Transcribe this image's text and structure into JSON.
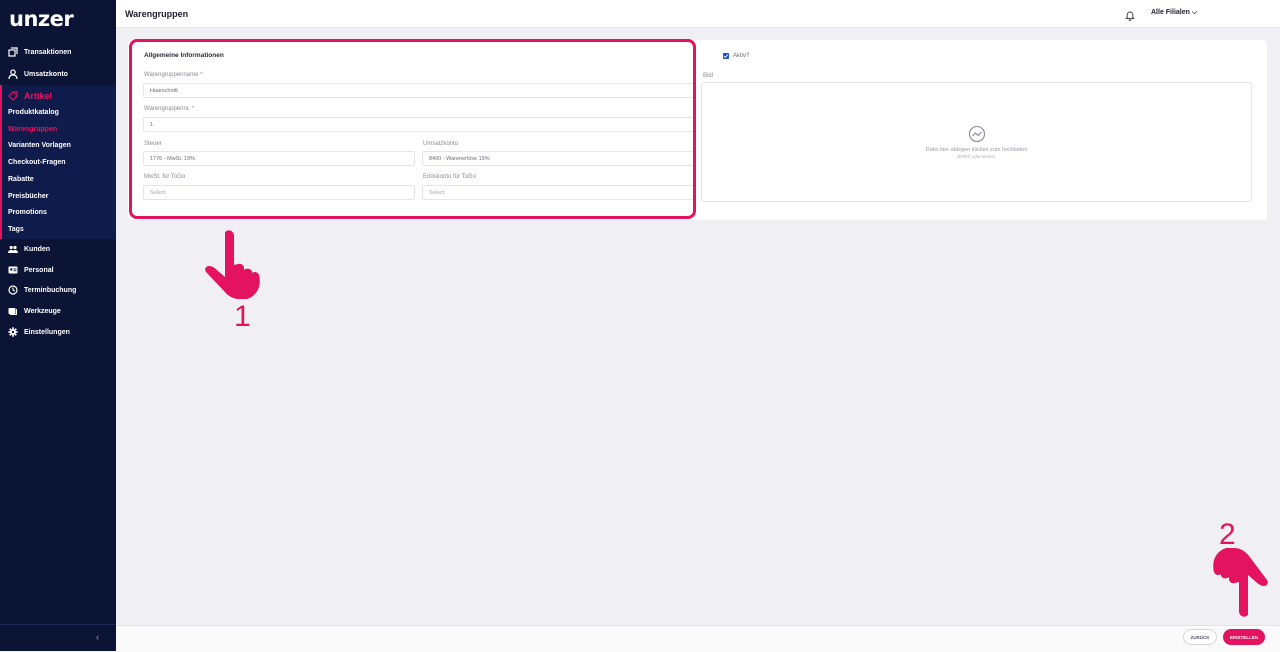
{
  "brand": {
    "logo": "unzer",
    "accent": "#e4135f",
    "sidebar_bg": "#0c1436"
  },
  "sidebar": {
    "items_top": [
      {
        "label": "Transaktionen",
        "icon": "transactions-icon"
      },
      {
        "label": "Umsatzkonto",
        "icon": "user-icon"
      }
    ],
    "artikel": {
      "label": "Artikel",
      "icon": "tag-icon",
      "sub_items": [
        {
          "label": "Produktkatalog",
          "active": false
        },
        {
          "label": "Warengruppen",
          "active": true
        },
        {
          "label": "Varianten Vorlagen",
          "active": false
        },
        {
          "label": "Checkout-Fragen",
          "active": false
        },
        {
          "label": "Rabatte",
          "active": false
        },
        {
          "label": "Preisbücher",
          "active": false
        },
        {
          "label": "Promotions",
          "active": false
        },
        {
          "label": "Tags",
          "active": false
        }
      ]
    },
    "items_bottom": [
      {
        "label": "Kunden",
        "icon": "people-icon"
      },
      {
        "label": "Personal",
        "icon": "id-card-icon"
      },
      {
        "label": "Terminbuchung",
        "icon": "clock-icon"
      },
      {
        "label": "Werkzeuge",
        "icon": "tools-icon"
      },
      {
        "label": "Einstellungen",
        "icon": "gear-icon"
      }
    ],
    "collapse": "‹"
  },
  "header": {
    "title": "Warengruppen",
    "filial": "Alle Filialen ⌵"
  },
  "form": {
    "section_title": "Allgemeine Informationen",
    "name": {
      "label": "Warengruppenname *",
      "value": "Haarschnitt"
    },
    "number": {
      "label": "Warengruppennr. *",
      "value": "1"
    },
    "steuer": {
      "label": "Steuer",
      "value": "1776 - MwSt. 19%"
    },
    "umsatzkonto": {
      "label": "Umsatzkonto",
      "value": "8400 - Warenerlöse 19%"
    },
    "mwst_togo": {
      "label": "MwSt. für ToGo",
      "placeholder": "Select"
    },
    "erloeskonto_togo": {
      "label": "Erlöskonto für ToGo",
      "placeholder": "Select"
    },
    "aktiv": {
      "label": "Aktiv?",
      "checked": true
    },
    "bild": {
      "label": "Bild",
      "drop_text": "Datei hier ablegen klicken zum hochladen",
      "drop_sub": "500Kb oder kleiner"
    }
  },
  "footer": {
    "back_label": "ZURÜCK",
    "create_label": "EINSTELLEN"
  },
  "annotations": {
    "step1": "1",
    "step2": "2"
  }
}
